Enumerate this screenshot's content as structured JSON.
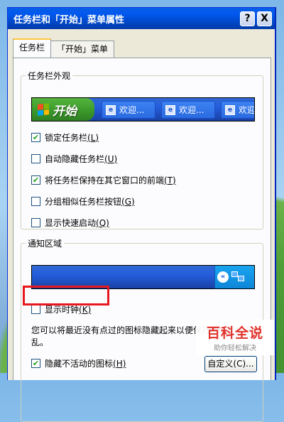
{
  "window": {
    "title": "任务栏和「开始」菜单属性",
    "help_label": "?",
    "close_label": "X"
  },
  "tabs": [
    {
      "label": "任务栏",
      "active": true
    },
    {
      "label": "「开始」菜单",
      "active": false
    }
  ],
  "appearance": {
    "legend": "任务栏外观",
    "start_label": "开始",
    "task_items": [
      "欢迎...",
      "欢迎...",
      "欢迎..."
    ],
    "options": [
      {
        "text": "锁定任务栏",
        "key": "(L)",
        "checked": true
      },
      {
        "text": "自动隐藏任务栏",
        "key": "(U)",
        "checked": false
      },
      {
        "text": "将任务栏保持在其它窗口的前端",
        "key": "(T)",
        "checked": true
      },
      {
        "text": "分组相似任务栏按钮",
        "key": "(G)",
        "checked": false
      },
      {
        "text": "显示快速启动",
        "key": "(Q)",
        "checked": false
      }
    ]
  },
  "notification": {
    "legend": "通知区域",
    "chevron": "«",
    "show_clock": {
      "text": "显示时钟",
      "key": "(K)",
      "checked": false
    },
    "description": "您可以将最近没有点过的图标隐藏起来以便保持通知区域不乱。",
    "hide_inactive": {
      "text": "隐藏不活动的图标",
      "key": "(H)",
      "checked": true
    },
    "customize_label": "自定义(C)..."
  },
  "watermark": {
    "title": "百科全说",
    "subtitle": "助你轻松解决"
  },
  "colors": {
    "highlight": "#e8181e",
    "titlebar": "#0058ee"
  }
}
